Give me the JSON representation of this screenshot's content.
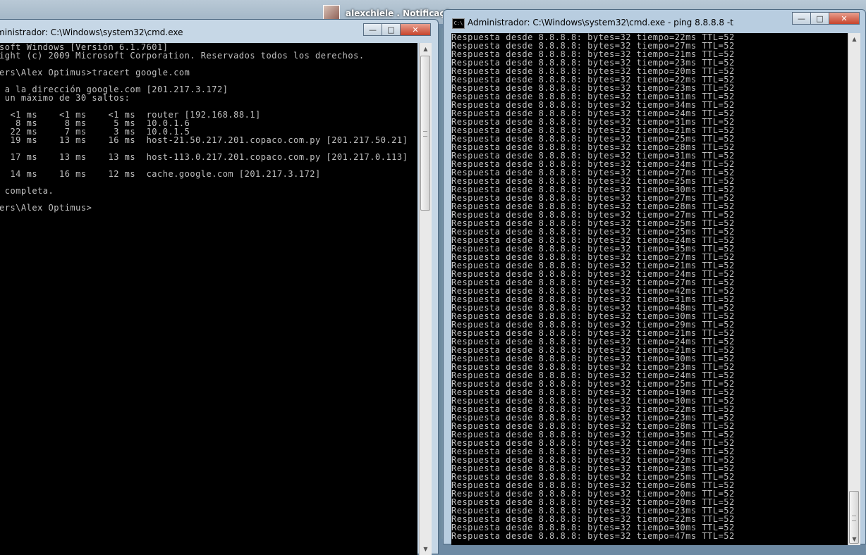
{
  "taskbar": {
    "user_label": "alexchiele .  Notificaçõ"
  },
  "left_window": {
    "title": "ministrador: C:\\Windows\\system32\\cmd.exe",
    "buttons": {
      "minimize": "—",
      "maximize": "□",
      "close": "✕"
    },
    "lines": [
      "soft Windows [Versión 6.1.7601]",
      "ight (c) 2009 Microsoft Corporation. Reservados todos los derechos.",
      "",
      "ers\\Alex Optimus>tracert google.com",
      "",
      " a la dirección google.com [201.217.3.172]",
      " un máximo de 30 saltos:",
      "",
      "  <1 ms    <1 ms    <1 ms  router [192.168.88.1]",
      "   8 ms     8 ms     5 ms  10.0.1.6",
      "  22 ms     7 ms     3 ms  10.0.1.5",
      "  19 ms    13 ms    16 ms  host-21.50.217.201.copaco.com.py [201.217.50.21]",
      "",
      "  17 ms    13 ms    13 ms  host-113.0.217.201.copaco.com.py [201.217.0.113]",
      "",
      "  14 ms    16 ms    12 ms  cache.google.com [201.217.3.172]",
      "",
      " completa.",
      "",
      "ers\\Alex Optimus>"
    ]
  },
  "right_window": {
    "title": "Administrador: C:\\Windows\\system32\\cmd.exe - ping  8.8.8.8 -t",
    "icon_text": "C:\\",
    "buttons": {
      "minimize": "—",
      "maximize": "□",
      "close": "✕"
    },
    "lines": [
      "Respuesta desde 8.8.8.8: bytes=32 tiempo=22ms TTL=52",
      "Respuesta desde 8.8.8.8: bytes=32 tiempo=27ms TTL=52",
      "Respuesta desde 8.8.8.8: bytes=32 tiempo=21ms TTL=52",
      "Respuesta desde 8.8.8.8: bytes=32 tiempo=23ms TTL=52",
      "Respuesta desde 8.8.8.8: bytes=32 tiempo=20ms TTL=52",
      "Respuesta desde 8.8.8.8: bytes=32 tiempo=22ms TTL=52",
      "Respuesta desde 8.8.8.8: bytes=32 tiempo=23ms TTL=52",
      "Respuesta desde 8.8.8.8: bytes=32 tiempo=31ms TTL=52",
      "Respuesta desde 8.8.8.8: bytes=32 tiempo=34ms TTL=52",
      "Respuesta desde 8.8.8.8: bytes=32 tiempo=24ms TTL=52",
      "Respuesta desde 8.8.8.8: bytes=32 tiempo=31ms TTL=52",
      "Respuesta desde 8.8.8.8: bytes=32 tiempo=21ms TTL=52",
      "Respuesta desde 8.8.8.8: bytes=32 tiempo=25ms TTL=52",
      "Respuesta desde 8.8.8.8: bytes=32 tiempo=28ms TTL=52",
      "Respuesta desde 8.8.8.8: bytes=32 tiempo=31ms TTL=52",
      "Respuesta desde 8.8.8.8: bytes=32 tiempo=24ms TTL=52",
      "Respuesta desde 8.8.8.8: bytes=32 tiempo=27ms TTL=52",
      "Respuesta desde 8.8.8.8: bytes=32 tiempo=25ms TTL=52",
      "Respuesta desde 8.8.8.8: bytes=32 tiempo=30ms TTL=52",
      "Respuesta desde 8.8.8.8: bytes=32 tiempo=27ms TTL=52",
      "Respuesta desde 8.8.8.8: bytes=32 tiempo=28ms TTL=52",
      "Respuesta desde 8.8.8.8: bytes=32 tiempo=27ms TTL=52",
      "Respuesta desde 8.8.8.8: bytes=32 tiempo=25ms TTL=52",
      "Respuesta desde 8.8.8.8: bytes=32 tiempo=25ms TTL=52",
      "Respuesta desde 8.8.8.8: bytes=32 tiempo=24ms TTL=52",
      "Respuesta desde 8.8.8.8: bytes=32 tiempo=35ms TTL=52",
      "Respuesta desde 8.8.8.8: bytes=32 tiempo=27ms TTL=52",
      "Respuesta desde 8.8.8.8: bytes=32 tiempo=21ms TTL=52",
      "Respuesta desde 8.8.8.8: bytes=32 tiempo=24ms TTL=52",
      "Respuesta desde 8.8.8.8: bytes=32 tiempo=27ms TTL=52",
      "Respuesta desde 8.8.8.8: bytes=32 tiempo=42ms TTL=52",
      "Respuesta desde 8.8.8.8: bytes=32 tiempo=31ms TTL=52",
      "Respuesta desde 8.8.8.8: bytes=32 tiempo=48ms TTL=52",
      "Respuesta desde 8.8.8.8: bytes=32 tiempo=30ms TTL=52",
      "Respuesta desde 8.8.8.8: bytes=32 tiempo=29ms TTL=52",
      "Respuesta desde 8.8.8.8: bytes=32 tiempo=21ms TTL=52",
      "Respuesta desde 8.8.8.8: bytes=32 tiempo=24ms TTL=52",
      "Respuesta desde 8.8.8.8: bytes=32 tiempo=21ms TTL=52",
      "Respuesta desde 8.8.8.8: bytes=32 tiempo=30ms TTL=52",
      "Respuesta desde 8.8.8.8: bytes=32 tiempo=23ms TTL=52",
      "Respuesta desde 8.8.8.8: bytes=32 tiempo=24ms TTL=52",
      "Respuesta desde 8.8.8.8: bytes=32 tiempo=25ms TTL=52",
      "Respuesta desde 8.8.8.8: bytes=32 tiempo=19ms TTL=52",
      "Respuesta desde 8.8.8.8: bytes=32 tiempo=30ms TTL=52",
      "Respuesta desde 8.8.8.8: bytes=32 tiempo=22ms TTL=52",
      "Respuesta desde 8.8.8.8: bytes=32 tiempo=23ms TTL=52",
      "Respuesta desde 8.8.8.8: bytes=32 tiempo=28ms TTL=52",
      "Respuesta desde 8.8.8.8: bytes=32 tiempo=35ms TTL=52",
      "Respuesta desde 8.8.8.8: bytes=32 tiempo=24ms TTL=52",
      "Respuesta desde 8.8.8.8: bytes=32 tiempo=29ms TTL=52",
      "Respuesta desde 8.8.8.8: bytes=32 tiempo=22ms TTL=52",
      "Respuesta desde 8.8.8.8: bytes=32 tiempo=23ms TTL=52",
      "Respuesta desde 8.8.8.8: bytes=32 tiempo=25ms TTL=52",
      "Respuesta desde 8.8.8.8: bytes=32 tiempo=26ms TTL=52",
      "Respuesta desde 8.8.8.8: bytes=32 tiempo=20ms TTL=52",
      "Respuesta desde 8.8.8.8: bytes=32 tiempo=20ms TTL=52",
      "Respuesta desde 8.8.8.8: bytes=32 tiempo=23ms TTL=52",
      "Respuesta desde 8.8.8.8: bytes=32 tiempo=22ms TTL=52",
      "Respuesta desde 8.8.8.8: bytes=32 tiempo=30ms TTL=52",
      "Respuesta desde 8.8.8.8: bytes=32 tiempo=47ms TTL=52"
    ]
  }
}
